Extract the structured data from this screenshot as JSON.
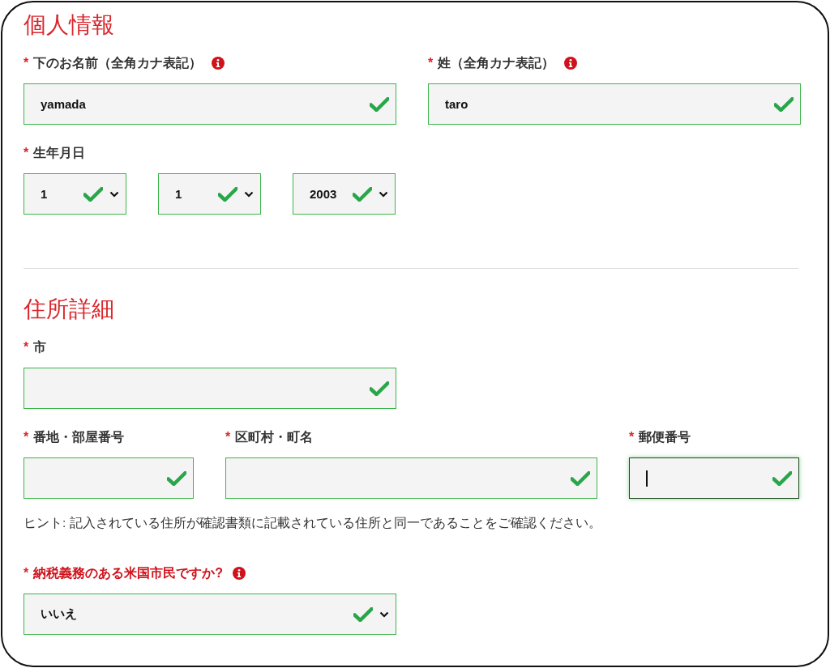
{
  "sections": [
    {
      "title": "個人情報",
      "rows": [
        {
          "fields": [
            {
              "kind": "text",
              "required_mark": "*",
              "label": "下のお名前（全角カナ表記）",
              "info": true,
              "highlighted": false,
              "value": "yamada",
              "valid": true,
              "focused": false
            },
            {
              "kind": "text",
              "required_mark": "*",
              "label": "姓（全角カナ表記）",
              "info": true,
              "highlighted": false,
              "value": "taro",
              "valid": true,
              "focused": false
            }
          ]
        },
        {
          "fields": [
            {
              "kind": "select",
              "required_mark": "*",
              "label": "生年月日",
              "info": false,
              "highlighted": false,
              "value": "1",
              "valid": true,
              "focused": false
            },
            {
              "kind": "select",
              "value": "1",
              "valid": true,
              "focused": false
            },
            {
              "kind": "select",
              "value": "2003",
              "valid": true,
              "focused": false
            }
          ]
        }
      ]
    },
    {
      "title": "住所詳細",
      "rows": [
        {
          "fields": [
            {
              "kind": "text",
              "required_mark": "*",
              "label": "市",
              "info": false,
              "highlighted": false,
              "valid": true,
              "focused": false
            }
          ]
        },
        {
          "fields": [
            {
              "kind": "text",
              "required_mark": "*",
              "label": "番地・部屋番号",
              "info": false,
              "highlighted": false,
              "valid": true,
              "focused": false
            },
            {
              "kind": "text",
              "required_mark": "*",
              "label": "区町村・町名",
              "info": false,
              "highlighted": false,
              "valid": true,
              "focused": false
            },
            {
              "kind": "text",
              "required_mark": "*",
              "label": "郵便番号",
              "info": false,
              "highlighted": false,
              "valid": true,
              "focused": true
            }
          ]
        },
        {
          "kind": "hint",
          "text": "ヒント: 記入されている住所が確認書類に記載されている住所と同一であることをご確認ください。"
        },
        {
          "fields": [
            {
              "kind": "select",
              "required_mark": "*",
              "label": "納税義務のある米国市民ですか?",
              "info": true,
              "highlighted": true,
              "value": "いいえ",
              "valid": true,
              "focused": false
            }
          ]
        }
      ]
    }
  ]
}
